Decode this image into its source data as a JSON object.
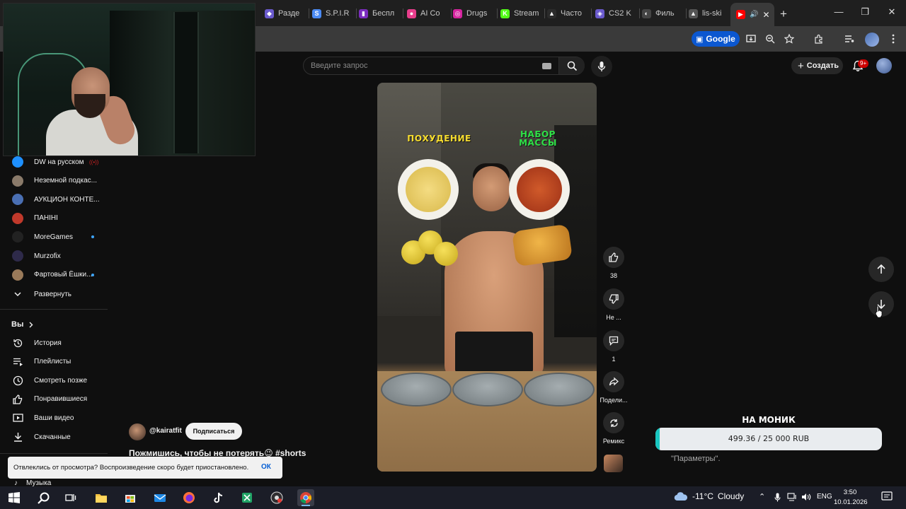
{
  "browser": {
    "tabs": [
      {
        "label": "Разде",
        "fav_color": "#6a5acd",
        "fav_glyph": "◆"
      },
      {
        "label": "S.P.I.R",
        "fav_color": "#4b8bf5",
        "fav_glyph": "S"
      },
      {
        "label": "Беспл",
        "fav_color": "#7b2cbf",
        "fav_glyph": "▮"
      },
      {
        "label": "AI Co",
        "fav_color": "#e83e8c",
        "fav_glyph": "●"
      },
      {
        "label": "Drugs",
        "fav_color": "#d6249f",
        "fav_glyph": "◎"
      },
      {
        "label": "Stream",
        "fav_color": "#53fc18",
        "fav_glyph": "K"
      },
      {
        "label": "Часто",
        "fav_color": "#2b2b2b",
        "fav_glyph": "▲"
      },
      {
        "label": "CS2 K",
        "fav_color": "#6a5acd",
        "fav_glyph": "◈"
      },
      {
        "label": "Филь",
        "fav_color": "#444444",
        "fav_glyph": "◐"
      },
      {
        "label": "lis-ski",
        "fav_color": "#555555",
        "fav_glyph": "▲"
      }
    ],
    "active_tab_icon": "youtube-icon",
    "google_chip": "Google"
  },
  "youtube": {
    "search_placeholder": "Введите запрос",
    "create_label": "Создать",
    "notif_badge": "9+"
  },
  "sidebar": {
    "subscriptions": [
      {
        "label": "DW на русском",
        "avatar_color": "#1e90ff",
        "marker": "live"
      },
      {
        "label": "Неземной подкас...",
        "avatar_color": "#8a7a6a",
        "marker": ""
      },
      {
        "label": "АУКЦИОН КОНТЕ...",
        "avatar_color": "#4a6fb3",
        "marker": ""
      },
      {
        "label": "ПАНІНІ",
        "avatar_color": "#c0392b",
        "marker": ""
      },
      {
        "label": "MoreGames",
        "avatar_color": "#222222",
        "marker": "dot"
      },
      {
        "label": "Murzofix",
        "avatar_color": "#2e2a4a",
        "marker": ""
      },
      {
        "label": "Фартовый Ёшки...",
        "avatar_color": "#9a7a5a",
        "marker": "dot"
      }
    ],
    "expand_label": "Развернуть",
    "you_section": "Вы",
    "you_items": [
      {
        "label": "История",
        "icon": "history-icon"
      },
      {
        "label": "Плейлисты",
        "icon": "playlists-icon"
      },
      {
        "label": "Смотреть позже",
        "icon": "watch-later-icon"
      },
      {
        "label": "Понравившиеся",
        "icon": "liked-icon"
      },
      {
        "label": "Ваши видео",
        "icon": "your-videos-icon"
      },
      {
        "label": "Скачанные",
        "icon": "downloads-icon"
      }
    ],
    "music_label": "Музыка"
  },
  "short": {
    "caption_left": "ПОХУДЕНИЕ",
    "caption_right": "НАБОР МАССЫ",
    "channel_handle": "@kairatfit",
    "subscribe_label": "Подписаться",
    "title": "Пожмишись, чтобы не потерять",
    "title_emoji": "😉",
    "hashtag": "#shorts",
    "actions": {
      "likes": "38",
      "dislike_label": "Не ...",
      "comments": "1",
      "share_label": "Подели...",
      "remix_label": "Ремикс"
    }
  },
  "donation": {
    "title": "НА МОНИК",
    "text": "499.36 / 25 000 RUB",
    "fraction": 0.02,
    "fill_color": "#19c6c0"
  },
  "params_note": "\"Параметры\".",
  "toast": {
    "message": "Отвлеклись от просмотра? Воспроизведение скоро будет приостановлено.",
    "ok_label": "ОК"
  },
  "taskbar": {
    "weather_temp": "-11°C",
    "weather_desc": "Cloudy",
    "lang": "ENG",
    "time": "3:50",
    "date": "10.01.2026"
  }
}
